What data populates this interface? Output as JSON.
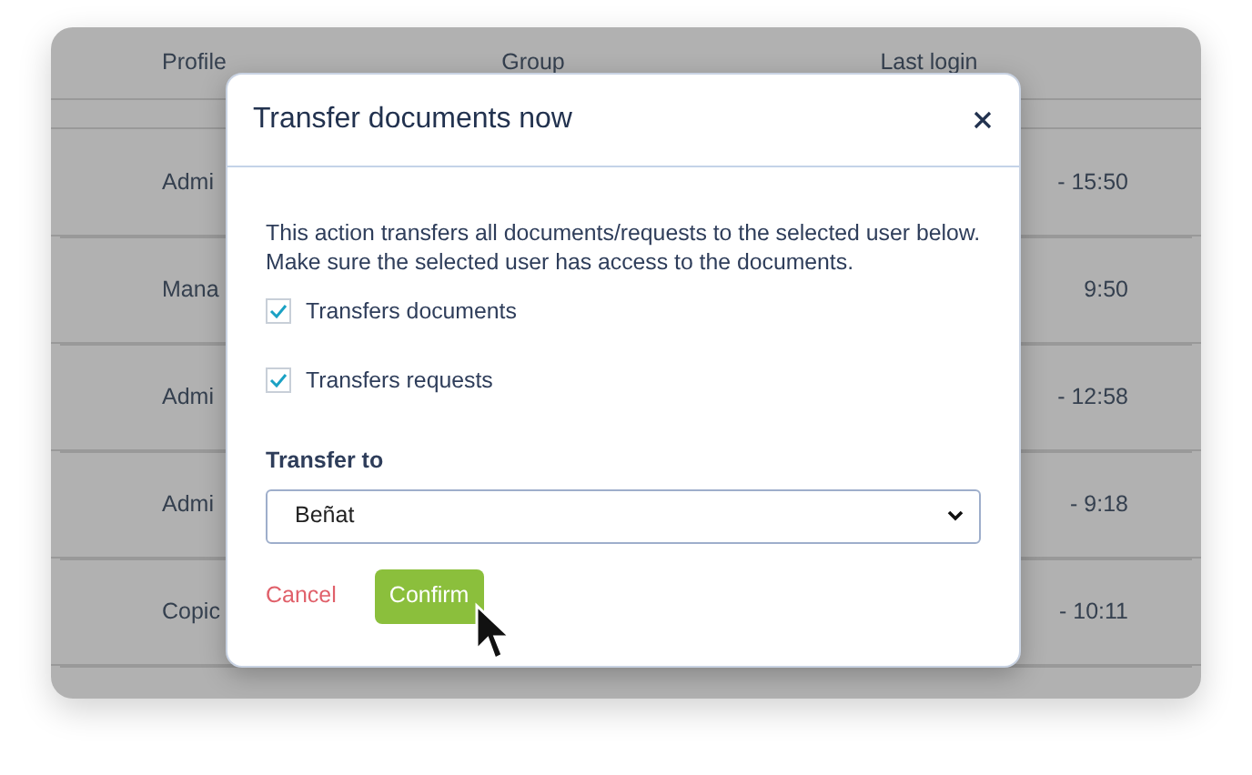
{
  "table": {
    "columns": [
      "Profile",
      "Group",
      "Last login"
    ],
    "rows": [
      {
        "profile": "Admi",
        "last_login": "- 15:50"
      },
      {
        "profile": "Mana",
        "last_login": "9:50"
      },
      {
        "profile": "Admi",
        "last_login": "- 12:58"
      },
      {
        "profile": "Admi",
        "last_login": "- 9:18"
      },
      {
        "profile": "Copic",
        "last_login": "- 10:11"
      }
    ]
  },
  "dialog": {
    "title": "Transfer documents now",
    "description": "This action transfers all documents/requests to the selected user below. Make sure the selected user has access to the documents.",
    "options": [
      {
        "label": "Transfers documents",
        "checked": true
      },
      {
        "label": "Transfers requests",
        "checked": true
      }
    ],
    "transfer_to": {
      "label": "Transfer to",
      "value": "Beñat"
    },
    "buttons": [
      {
        "label": "Cancel",
        "kind": "link"
      },
      {
        "label": "Confirm",
        "kind": "primary"
      }
    ]
  }
}
